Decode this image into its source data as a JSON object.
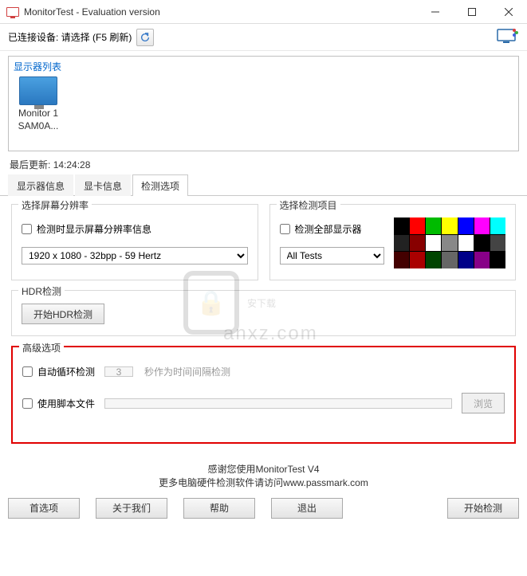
{
  "window": {
    "title": "MonitorTest - Evaluation version"
  },
  "toolbar": {
    "connected_device_label": "已连接设备: 请选择 (F5 刷新)"
  },
  "monitor_list": {
    "title": "显示器列表",
    "items": [
      {
        "line1": "Monitor 1",
        "line2": "SAM0A..."
      }
    ]
  },
  "last_update": {
    "label": "最后更新:",
    "time": "14:24:28"
  },
  "tabs": [
    {
      "label": "显示器信息"
    },
    {
      "label": "显卡信息"
    },
    {
      "label": "检测选项"
    }
  ],
  "resolution_group": {
    "legend": "选择屏幕分辨率",
    "checkbox_label": "检测时显示屏幕分辨率信息",
    "select_value": "1920 x 1080 - 32bpp - 59 Hertz"
  },
  "test_items_group": {
    "legend": "选择检测项目",
    "checkbox_label": "检测全部显示器",
    "select_value": "All Tests"
  },
  "hdr_group": {
    "legend": "HDR检测",
    "button_label": "开始HDR检测"
  },
  "advanced_group": {
    "legend": "高级选项",
    "auto_loop_label": "自动循环检测",
    "auto_loop_value": "3",
    "auto_loop_hint": "秒作为时间间隔检测",
    "use_script_label": "使用脚本文件",
    "script_path": "",
    "browse_label": "浏览"
  },
  "footer": {
    "line1": "感谢您使用MonitorTest V4",
    "line2_prefix": "更多电脑硬件检测软件请访问",
    "line2_link": "www.passmark.com"
  },
  "bottom_buttons": {
    "preferences": "首选项",
    "about": "关于我们",
    "help": "帮助",
    "exit": "退出",
    "start": "开始检测"
  }
}
